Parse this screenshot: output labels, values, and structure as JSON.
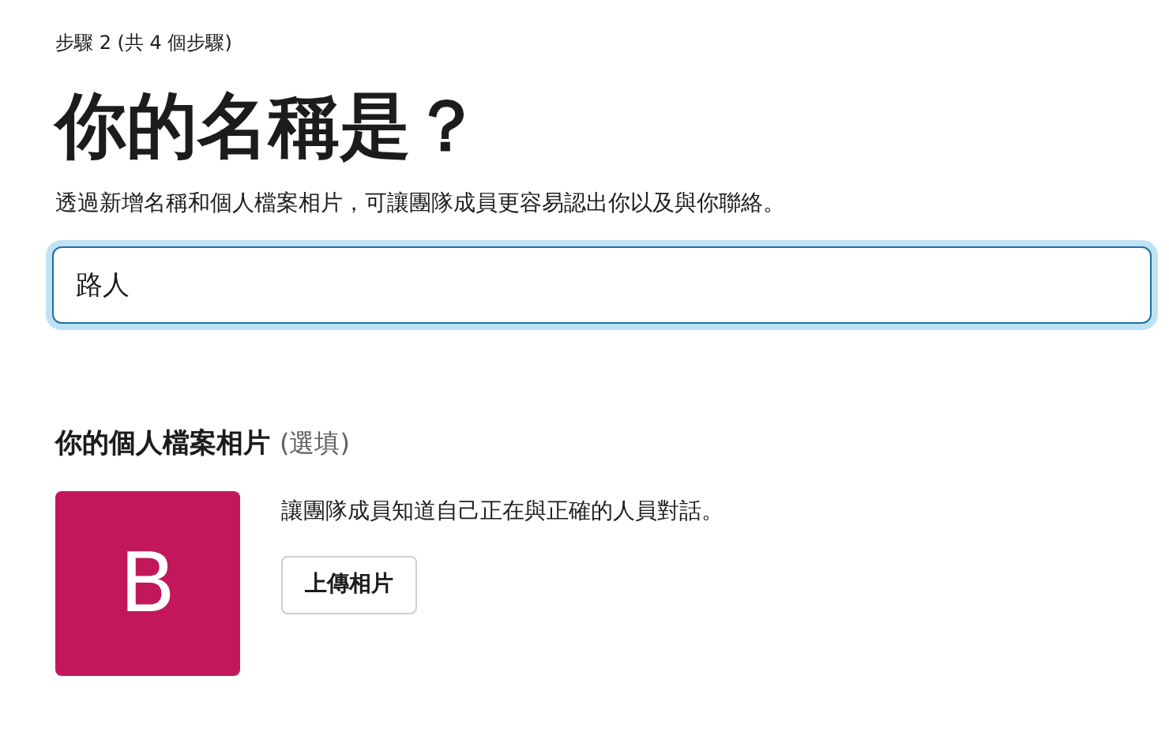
{
  "step_label": "步驟 2 (共 4 個步驟)",
  "title": "你的名稱是？",
  "description": "透過新增名稱和個人檔案相片，可讓團隊成員更容易認出你以及與你聯絡。",
  "name_field": {
    "value": "路人",
    "focused": true
  },
  "photo_section": {
    "heading": "你的個人檔案相片",
    "optional_note": "(選填)",
    "avatar": {
      "initial": "B",
      "color": "#c2185b"
    },
    "hint": "讓團隊成員知道自己正在與正確的人員對話。",
    "upload_button": "上傳相片"
  }
}
